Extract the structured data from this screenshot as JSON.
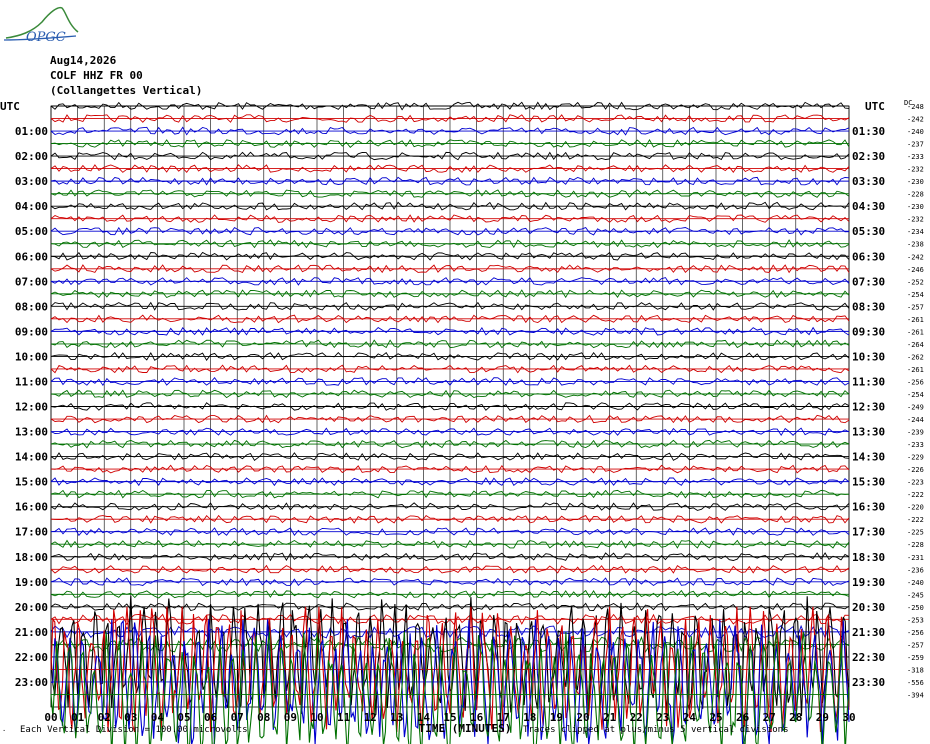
{
  "logo": {
    "text": "OPGC"
  },
  "header": {
    "date": "Aug14,2026",
    "station": "COLF HHZ FR 00",
    "location": "(Collangettes Vertical)"
  },
  "footer": {
    "scale_note": "Each Vertical Division = 100.00 microvolts",
    "clip_note": "Traces clipped at plus/minus 5 vertical divisions"
  },
  "colors": {
    "cycle": [
      "#000000",
      "#d00000",
      "#0000d0",
      "#007000"
    ],
    "grid": "#000000"
  },
  "chart_data": {
    "type": "line",
    "title": "COLF HHZ FR 00",
    "xlabel": "TIME (MINUTES)",
    "left_axis_title": "UTC",
    "right_axis_title": "UTC",
    "dc_label": "DC",
    "x_ticks": [
      "00",
      "01",
      "02",
      "03",
      "04",
      "05",
      "06",
      "07",
      "08",
      "09",
      "10",
      "11",
      "12",
      "13",
      "14",
      "15",
      "16",
      "17",
      "18",
      "19",
      "20",
      "21",
      "22",
      "23",
      "24",
      "25",
      "26",
      "27",
      "28",
      "29",
      "30"
    ],
    "xlim": [
      0,
      30
    ],
    "left_labels": [
      "UTC",
      "01:00",
      "02:00",
      "03:00",
      "04:00",
      "05:00",
      "06:00",
      "07:00",
      "08:00",
      "09:00",
      "10:00",
      "11:00",
      "12:00",
      "13:00",
      "14:00",
      "15:00",
      "16:00",
      "17:00",
      "18:00",
      "19:00",
      "20:00",
      "21:00",
      "22:00",
      "23:00"
    ],
    "right_labels": [
      "UTC",
      "01:30",
      "02:30",
      "03:30",
      "04:30",
      "05:30",
      "06:30",
      "07:30",
      "08:30",
      "09:30",
      "10:30",
      "11:30",
      "12:30",
      "13:30",
      "14:30",
      "15:30",
      "16:30",
      "17:30",
      "18:30",
      "19:30",
      "20:30",
      "21:30",
      "22:30",
      "23:30"
    ],
    "dc_offsets": [
      -248,
      -242,
      -240,
      -237,
      -233,
      -232,
      -230,
      -228,
      -230,
      -232,
      -234,
      -238,
      -242,
      -246,
      -252,
      -254,
      -257,
      -261,
      -261,
      -264,
      -262,
      -261,
      -256,
      -254,
      -249,
      -244,
      -239,
      -233,
      -229,
      -226,
      -223,
      -222,
      -220,
      -222,
      -225,
      -228,
      -231,
      -236,
      -240,
      -245,
      -250,
      -253,
      -256,
      -257,
      -259,
      -318,
      -556,
      -394
    ],
    "trace_count": 48,
    "amplitude_divisions": [
      0.3,
      0.3,
      0.3,
      0.3,
      0.3,
      0.3,
      0.3,
      0.3,
      0.3,
      0.3,
      0.3,
      0.3,
      0.3,
      0.3,
      0.3,
      0.3,
      0.3,
      0.3,
      0.3,
      0.3,
      0.3,
      0.3,
      0.3,
      0.3,
      0.3,
      0.3,
      0.3,
      0.3,
      0.3,
      0.3,
      0.3,
      0.3,
      0.3,
      0.3,
      0.3,
      0.3,
      0.3,
      0.3,
      0.3,
      0.3,
      0.3,
      0.4,
      0.5,
      0.6,
      4.5,
      5,
      5,
      5
    ],
    "clip_divisions": 5,
    "microvolts_per_division": 100.0
  }
}
